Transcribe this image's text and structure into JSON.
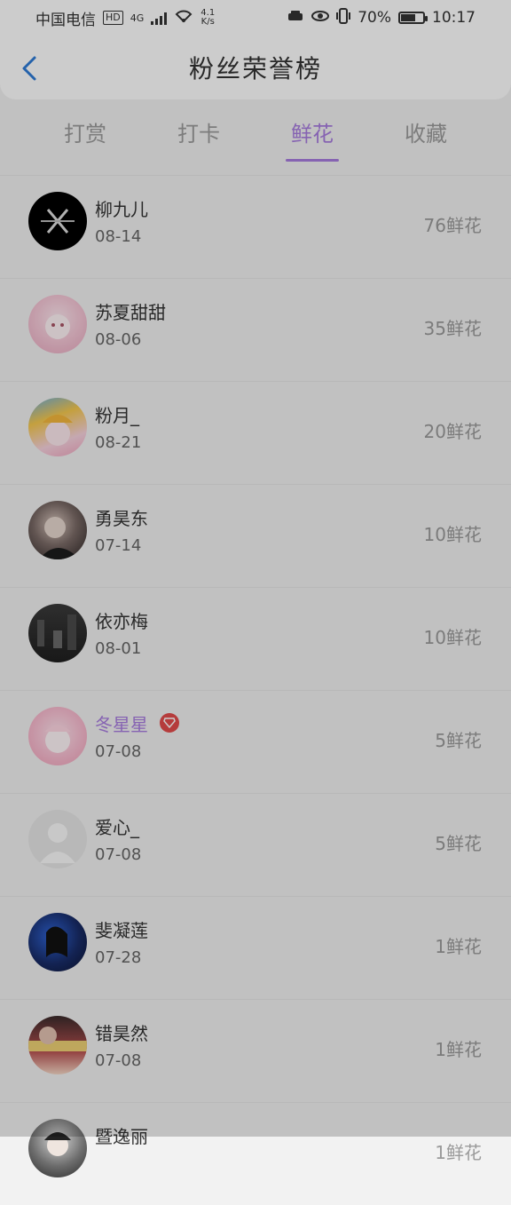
{
  "status_bar": {
    "carrier": "中国电信",
    "hd": "HD",
    "network": "4G",
    "speed_value": "4.1",
    "speed_unit": "K/s",
    "battery": "70%",
    "time": "10:17"
  },
  "header": {
    "title": "粉丝荣誉榜"
  },
  "tabs": [
    {
      "label": "打赏",
      "active": false
    },
    {
      "label": "打卡",
      "active": false
    },
    {
      "label": "鲜花",
      "active": true
    },
    {
      "label": "收藏",
      "active": false
    }
  ],
  "fans": [
    {
      "name": "柳九儿",
      "date": "08-14",
      "amount": "76鲜花",
      "vip": false
    },
    {
      "name": "苏夏甜甜",
      "date": "08-06",
      "amount": "35鲜花",
      "vip": false
    },
    {
      "name": "粉月_",
      "date": "08-21",
      "amount": "20鲜花",
      "vip": false
    },
    {
      "name": "勇昊东",
      "date": "07-14",
      "amount": "10鲜花",
      "vip": false
    },
    {
      "name": "依亦梅",
      "date": "08-01",
      "amount": "10鲜花",
      "vip": false
    },
    {
      "name": "冬星星",
      "date": "07-08",
      "amount": "5鲜花",
      "vip": true
    },
    {
      "name": "爱心_",
      "date": "07-08",
      "amount": "5鲜花",
      "vip": false
    },
    {
      "name": "斐凝莲",
      "date": "07-28",
      "amount": "1鲜花",
      "vip": false
    },
    {
      "name": "错昊然",
      "date": "07-08",
      "amount": "1鲜花",
      "vip": false
    },
    {
      "name": "暨逸丽",
      "date": "",
      "amount": "1鲜花",
      "vip": false
    }
  ],
  "colors": {
    "accent": "#a87cdf",
    "vip_badge": "#e34b4b",
    "back_arrow": "#2d7bd6"
  }
}
